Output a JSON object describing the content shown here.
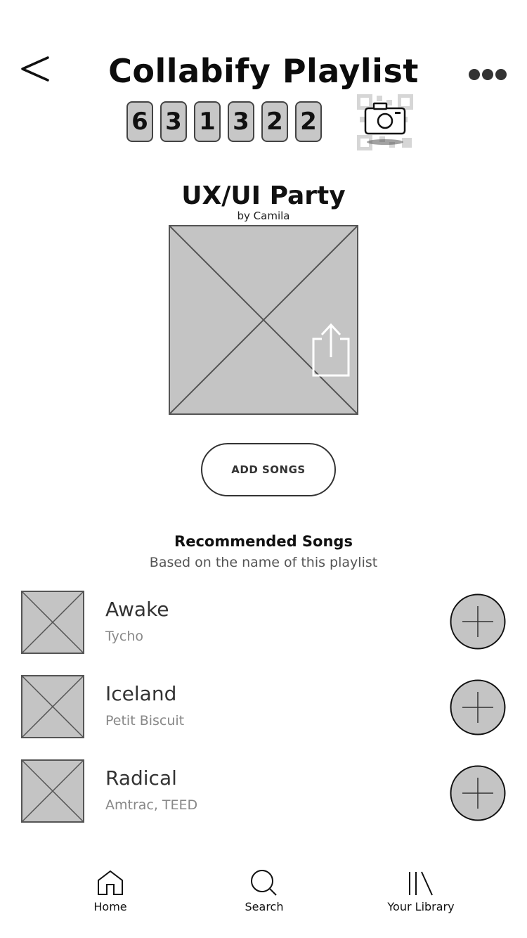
{
  "header": {
    "title": "Collabify Playlist"
  },
  "code": {
    "digits": [
      "6",
      "3",
      "1",
      "3",
      "2",
      "2"
    ]
  },
  "playlist": {
    "name": "UX/UI Party",
    "owner": "by Camila",
    "add_songs_label": "ADD SONGS"
  },
  "recommended": {
    "title": "Recommended Songs",
    "subtitle": "Based on the name of this playlist",
    "songs": [
      {
        "title": "Awake",
        "artist": "Tycho"
      },
      {
        "title": "Iceland",
        "artist": "Petit Biscuit"
      },
      {
        "title": "Radical",
        "artist": "Amtrac, TEED"
      }
    ]
  },
  "nav": {
    "items": [
      {
        "label": "Home",
        "icon": "home-icon"
      },
      {
        "label": "Search",
        "icon": "search-icon"
      },
      {
        "label": "Your Library",
        "icon": "library-icon"
      }
    ]
  },
  "colors": {
    "placeholder_fill": "#c4c4c4",
    "placeholder_stroke": "#555555"
  }
}
